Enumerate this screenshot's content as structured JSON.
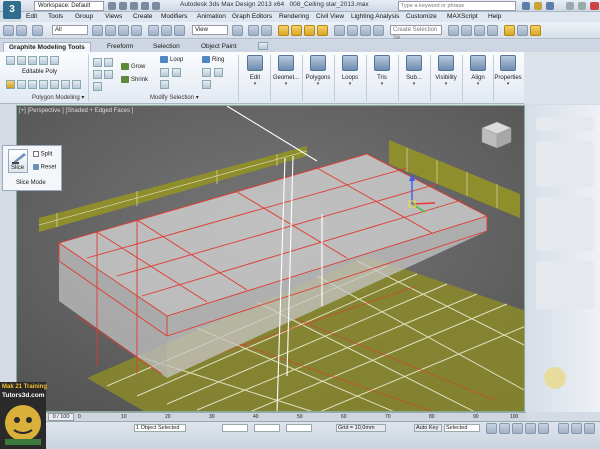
{
  "titlebar": {
    "workspace": "Workspace: Default",
    "app_title": "Autodesk 3ds Max Design 2013 x64",
    "file_name": "008_Ceiling star_2013.max",
    "search_placeholder": "Type a keyword or phrase"
  },
  "menu": [
    "Edit",
    "Tools",
    "Group",
    "Views",
    "Create",
    "Modifiers",
    "Animation",
    "Graph Editors",
    "Rendering",
    "Civil View",
    "Lighting Analysis",
    "Customize",
    "MAXScript",
    "Help"
  ],
  "toolbar": {
    "filter_value": "All",
    "refcoord_value": "View",
    "selection_set_placeholder": "Create Selection Se"
  },
  "ribbon_tabs": [
    "Graphite Modeling Tools",
    "Freeform",
    "Selection",
    "Object Paint"
  ],
  "ribbon": {
    "polygon_modeling": {
      "label": "Polygon Modeling",
      "object": "Editable Poly"
    },
    "modify_selection": {
      "label": "Modify Selection",
      "grow": "Grow",
      "shrink": "Shrink",
      "loop": "Loop",
      "ring": "Ring"
    },
    "buttons": [
      "Edit",
      "Geomet...",
      "Polygons",
      "Loops",
      "Tris",
      "Sub...",
      "Visibility",
      "Align",
      "Properties"
    ]
  },
  "viewport": {
    "label": "[+] [Perspective ] [Shaded + Edged Faces ]"
  },
  "slice_mode": {
    "title": "Slice Mode",
    "slice": "Slice",
    "split": "Split",
    "reset": "Reset"
  },
  "timeline": {
    "frame_total": "100",
    "ticks": [
      "0",
      "10",
      "20",
      "30",
      "40",
      "50",
      "60",
      "70",
      "80",
      "90",
      "100"
    ]
  },
  "status": {
    "objects_selected": "1 Object Selected",
    "grid": "Grid = 10,0mm",
    "auto_key": "Auto Key",
    "key_mode": "Selected"
  },
  "watermark": {
    "line1": "Mak 21 Training",
    "line2": "Tutors3d.com"
  },
  "colors": {
    "accent_yellow": "#d6a52a",
    "viewport_bg": "#626262",
    "edge_red": "#e03a2e",
    "olive_panel": "#8a8a2a"
  }
}
